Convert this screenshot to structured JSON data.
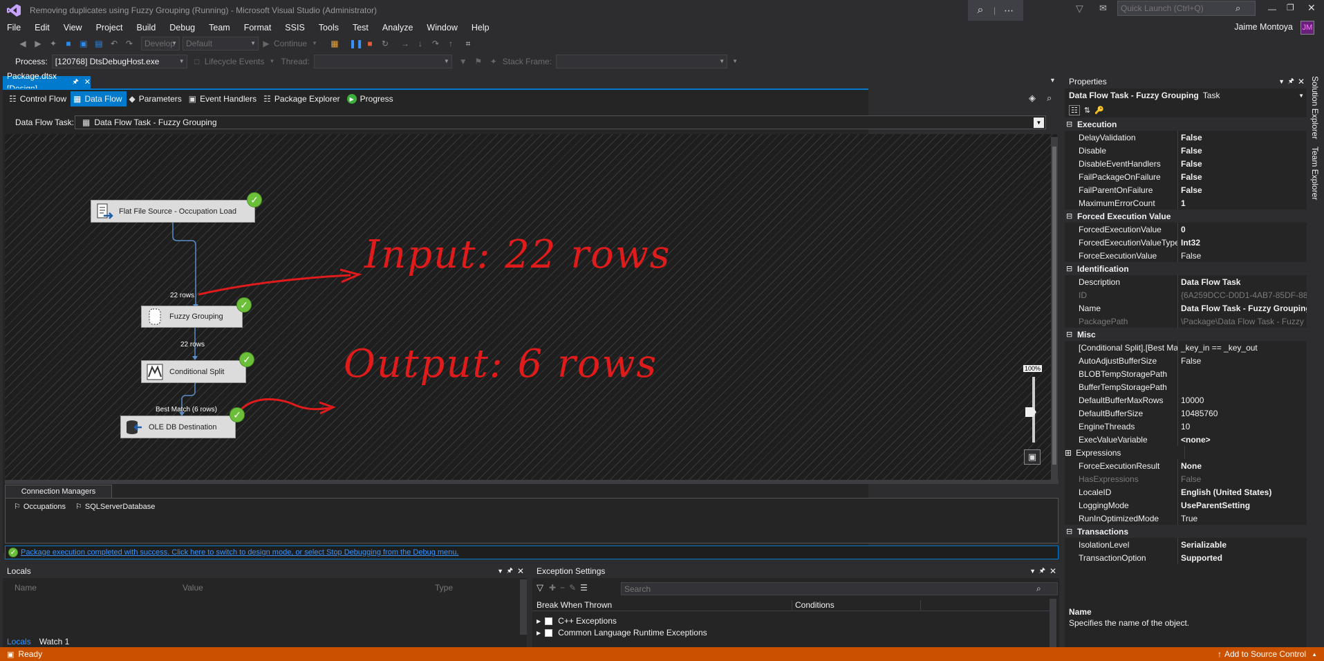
{
  "window": {
    "title": "Removing duplicates using Fuzzy Grouping (Running) - Microsoft Visual Studio  (Administrator)",
    "quick_launch_placeholder": "Quick Launch (Ctrl+Q)",
    "user_name": "Jaime Montoya",
    "user_initials": "JM"
  },
  "menu": [
    "File",
    "Edit",
    "View",
    "Project",
    "Build",
    "Debug",
    "Team",
    "Format",
    "SSIS",
    "Tools",
    "Test",
    "Analyze",
    "Window",
    "Help"
  ],
  "toolbar": {
    "config": "Develop",
    "platform": "Default",
    "continue_label": "Continue",
    "process_label": "Process:",
    "process_value": "[120768] DtsDebugHost.exe",
    "lifecycle_label": "Lifecycle Events",
    "thread_label": "Thread:",
    "stack_frame_label": "Stack Frame:"
  },
  "document": {
    "tab_label": "Package.dtsx [Design]",
    "designer_tabs": [
      "Control Flow",
      "Data Flow",
      "Parameters",
      "Event Handlers",
      "Package Explorer",
      "Progress"
    ],
    "active_tab": "Data Flow",
    "data_flow_task_label": "Data Flow Task:",
    "data_flow_task_value": "Data Flow Task - Fuzzy Grouping"
  },
  "canvas": {
    "nodes": {
      "source": "Flat File Source - Occupation Load",
      "fuzzy": "Fuzzy Grouping",
      "split": "Conditional Split",
      "dest": "OLE DB Destination"
    },
    "paths": {
      "p1": "22 rows",
      "p2": "22 rows",
      "p3": "Best Match (6 rows)"
    },
    "annotations": {
      "input": "Input: 22 rows",
      "output": "Output: 6 rows"
    },
    "zoom_label": "100%"
  },
  "connection_managers": {
    "tab_label": "Connection Managers",
    "items": [
      "Occupations",
      "SQLServerDatabase"
    ]
  },
  "status_message": "Package execution completed with success. Click here to switch to design mode, or select Stop Debugging from the Debug menu.",
  "locals": {
    "title": "Locals",
    "columns": [
      "Name",
      "Value",
      "Type"
    ],
    "bottom_tabs": [
      "Locals",
      "Watch 1"
    ]
  },
  "exceptions": {
    "title": "Exception Settings",
    "search_placeholder": "Search",
    "columns": [
      "Break When Thrown",
      "Conditions"
    ],
    "items": [
      "C++ Exceptions",
      "Common Language Runtime Exceptions"
    ]
  },
  "properties": {
    "title": "Properties",
    "object_name": "Data Flow Task - Fuzzy Grouping",
    "object_type": "Task",
    "categories": [
      {
        "name": "Execution",
        "rows": [
          {
            "k": "DelayValidation",
            "v": "False",
            "b": true
          },
          {
            "k": "Disable",
            "v": "False",
            "b": true
          },
          {
            "k": "DisableEventHandlers",
            "v": "False",
            "b": true
          },
          {
            "k": "FailPackageOnFailure",
            "v": "False",
            "b": true
          },
          {
            "k": "FailParentOnFailure",
            "v": "False",
            "b": true
          },
          {
            "k": "MaximumErrorCount",
            "v": "1",
            "b": true
          }
        ]
      },
      {
        "name": "Forced Execution Value",
        "rows": [
          {
            "k": "ForcedExecutionValue",
            "v": "0",
            "b": true
          },
          {
            "k": "ForcedExecutionValueType",
            "v": "Int32",
            "b": true
          },
          {
            "k": "ForceExecutionValue",
            "v": "False",
            "b": false
          }
        ]
      },
      {
        "name": "Identification",
        "rows": [
          {
            "k": "Description",
            "v": "Data Flow Task",
            "b": true
          },
          {
            "k": "ID",
            "v": "{6A259DCC-D0D1-4AB7-85DF-88",
            "b": false,
            "g": true
          },
          {
            "k": "Name",
            "v": "Data Flow Task - Fuzzy Grouping",
            "b": true
          },
          {
            "k": "PackagePath",
            "v": "\\Package\\Data Flow Task - Fuzzy",
            "b": false,
            "g": true
          }
        ]
      },
      {
        "name": "Misc",
        "rows": [
          {
            "k": "[Conditional Split].[Best Mat",
            "v": "_key_in == _key_out",
            "b": false
          },
          {
            "k": "AutoAdjustBufferSize",
            "v": "False",
            "b": false
          },
          {
            "k": "BLOBTempStoragePath",
            "v": "",
            "b": false
          },
          {
            "k": "BufferTempStoragePath",
            "v": "",
            "b": false
          },
          {
            "k": "DefaultBufferMaxRows",
            "v": "10000",
            "b": false
          },
          {
            "k": "DefaultBufferSize",
            "v": "10485760",
            "b": false
          },
          {
            "k": "EngineThreads",
            "v": "10",
            "b": false
          },
          {
            "k": "ExecValueVariable",
            "v": "<none>",
            "b": true
          },
          {
            "k": "Expressions",
            "v": "",
            "b": false,
            "expander": true
          },
          {
            "k": "ForceExecutionResult",
            "v": "None",
            "b": true
          },
          {
            "k": "HasExpressions",
            "v": "False",
            "b": false,
            "g": true
          },
          {
            "k": "LocaleID",
            "v": "English (United States)",
            "b": true
          },
          {
            "k": "LoggingMode",
            "v": "UseParentSetting",
            "b": true
          },
          {
            "k": "RunInOptimizedMode",
            "v": "True",
            "b": false
          }
        ]
      },
      {
        "name": "Transactions",
        "rows": [
          {
            "k": "IsolationLevel",
            "v": "Serializable",
            "b": true
          },
          {
            "k": "TransactionOption",
            "v": "Supported",
            "b": true
          }
        ]
      }
    ],
    "description_title": "Name",
    "description_text": "Specifies the name of the object."
  },
  "side_tabs": [
    "Solution Explorer",
    "Team Explorer"
  ],
  "statusbar": {
    "left": "Ready",
    "right": "Add to Source Control"
  },
  "colors": {
    "accent": "#007acc",
    "statusbar": "#ca5100",
    "annotation": "#e01b1b",
    "success": "#6cbf3a"
  }
}
